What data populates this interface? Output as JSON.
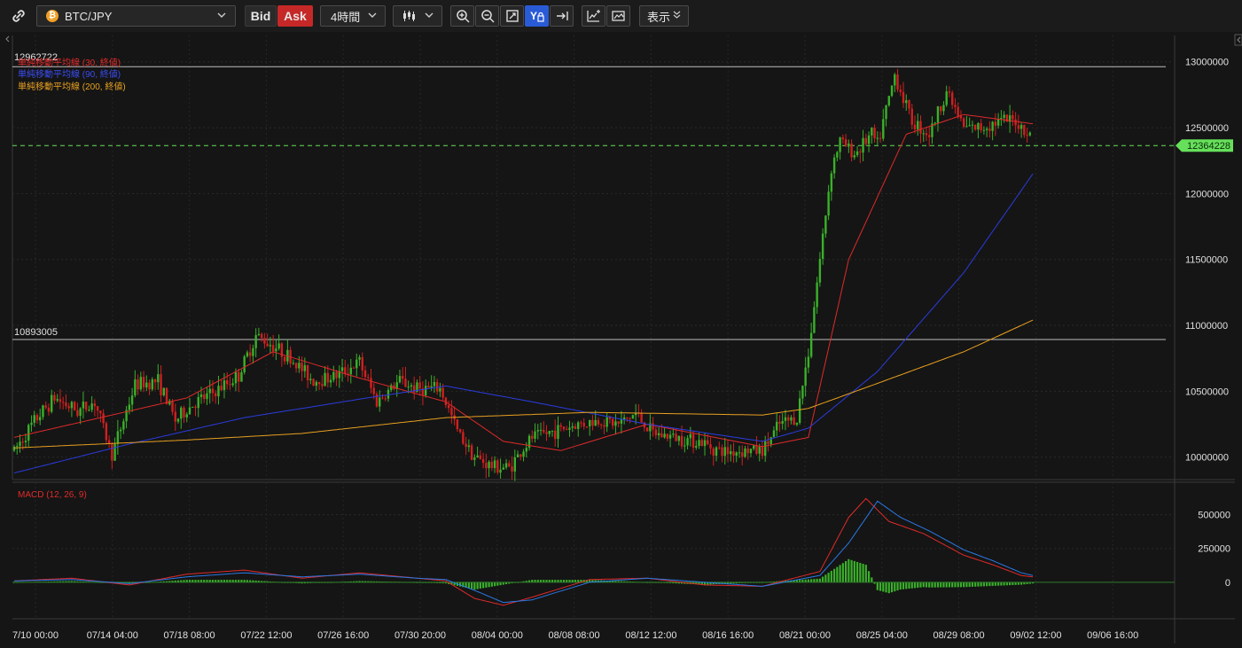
{
  "toolbar": {
    "symbol": "BTC/JPY",
    "bid_label": "Bid",
    "ask_label": "Ask",
    "timeframe": "4時間",
    "display_label": "表示",
    "icons": [
      "link-icon",
      "bitcoin-icon",
      "chevron-down-icon",
      "candlestick-icon",
      "zoom-in-icon",
      "zoom-out-icon",
      "fit-icon",
      "yen-lock-icon",
      "scroll-to-end-icon",
      "add-indicator-icon",
      "screenshot-icon"
    ]
  },
  "colors": {
    "up_candle": "#3ab02a",
    "down_candle": "#d02020",
    "sma30": "#e02a2a",
    "sma90": "#2a3ce0",
    "sma200": "#e8a020",
    "price_line": "#66e05a",
    "bid_bg": "#2a2a2a",
    "ask_bg": "#c62828",
    "active_toggle": "#2a5bd7"
  },
  "main_chart": {
    "legend": [
      "単純移動平均線 (30, 終値)",
      "単純移動平均線 (90, 終値)",
      "単純移動平均線 (200, 終値)"
    ],
    "high_line_label": "12962722",
    "low_line_label": "10893005",
    "high_line_value": 12962722,
    "low_line_value": 10893005,
    "current_price_label": "12364228",
    "current_price_value": 12364228
  },
  "macd_chart": {
    "label": "MACD (12, 26, 9)"
  },
  "chart_data": {
    "type": "line",
    "title": "",
    "xlabel": "",
    "ylabel": "",
    "x_ticks": [
      "7/10 00:00",
      "07/14 04:00",
      "07/18 08:00",
      "07/22 12:00",
      "07/26 16:00",
      "07/30 20:00",
      "08/04 00:00",
      "08/08 08:00",
      "08/12 12:00",
      "08/16 16:00",
      "08/21 00:00",
      "08/25 04:00",
      "08/29 08:00",
      "09/02 12:00",
      "09/06 16:00"
    ],
    "price_axis": {
      "ylim": [
        9830000,
        13200000
      ],
      "ticks": [
        "13000000",
        "12500000",
        "12000000",
        "11500000",
        "11000000",
        "10500000",
        "10000000"
      ],
      "tick_values": [
        13000000,
        12500000,
        12000000,
        11500000,
        11000000,
        10500000,
        10000000
      ]
    },
    "macd_axis": {
      "ylim": [
        -270000,
        740000
      ],
      "ticks": [
        "500000",
        "250000",
        "0"
      ],
      "tick_values": [
        500000,
        250000,
        0
      ]
    },
    "grid": true,
    "candles": {
      "count": 300,
      "anchors": [
        [
          0,
          10050000
        ],
        [
          8,
          10300000
        ],
        [
          14,
          10450000
        ],
        [
          22,
          10350000
        ],
        [
          28,
          10420000
        ],
        [
          34,
          10020000
        ],
        [
          42,
          10550000
        ],
        [
          50,
          10580000
        ],
        [
          56,
          10280000
        ],
        [
          62,
          10400000
        ],
        [
          70,
          10500000
        ],
        [
          78,
          10620000
        ],
        [
          84,
          10920000
        ],
        [
          90,
          10850000
        ],
        [
          96,
          10750000
        ],
        [
          104,
          10580000
        ],
        [
          112,
          10620000
        ],
        [
          120,
          10720000
        ],
        [
          126,
          10420000
        ],
        [
          134,
          10580000
        ],
        [
          140,
          10520000
        ],
        [
          148,
          10520000
        ],
        [
          154,
          10200000
        ],
        [
          160,
          10000000
        ],
        [
          166,
          9930000
        ],
        [
          172,
          9920000
        ],
        [
          180,
          10150000
        ],
        [
          188,
          10200000
        ],
        [
          196,
          10250000
        ],
        [
          204,
          10280000
        ],
        [
          210,
          10250000
        ],
        [
          216,
          10330000
        ],
        [
          222,
          10180000
        ],
        [
          230,
          10150000
        ],
        [
          238,
          10120000
        ],
        [
          246,
          10040000
        ],
        [
          254,
          10050000
        ],
        [
          260,
          10050000
        ],
        [
          266,
          10250000
        ],
        [
          272,
          10300000
        ],
        [
          276,
          10800000
        ],
        [
          280,
          11500000
        ],
        [
          284,
          12200000
        ],
        [
          287,
          12400000
        ],
        [
          292,
          12300000
        ],
        [
          298,
          12450000
        ],
        [
          300,
          12364228
        ]
      ],
      "tail_anchors": [
        [
          300,
          12364228
        ],
        [
          306,
          12900000
        ],
        [
          312,
          12550000
        ],
        [
          318,
          12450000
        ],
        [
          324,
          12780000
        ],
        [
          330,
          12500000
        ],
        [
          336,
          12500000
        ],
        [
          342,
          12550000
        ],
        [
          348,
          12550000
        ],
        [
          354,
          12420000
        ]
      ]
    },
    "series": [
      {
        "name": "単純移動平均線 (30, 終値)",
        "anchors": [
          [
            0,
            10150000
          ],
          [
            60,
            10450000
          ],
          [
            90,
            10800000
          ],
          [
            120,
            10600000
          ],
          [
            150,
            10420000
          ],
          [
            170,
            10120000
          ],
          [
            190,
            10050000
          ],
          [
            220,
            10250000
          ],
          [
            260,
            10080000
          ],
          [
            276,
            10150000
          ],
          [
            290,
            11500000
          ],
          [
            310,
            12450000
          ],
          [
            330,
            12600000
          ],
          [
            354,
            12530000
          ]
        ]
      },
      {
        "name": "単純移動平均線 (90, 終値)",
        "anchors": [
          [
            0,
            9880000
          ],
          [
            40,
            10100000
          ],
          [
            80,
            10300000
          ],
          [
            120,
            10440000
          ],
          [
            150,
            10540000
          ],
          [
            180,
            10420000
          ],
          [
            220,
            10250000
          ],
          [
            260,
            10120000
          ],
          [
            276,
            10220000
          ],
          [
            300,
            10650000
          ],
          [
            330,
            11400000
          ],
          [
            354,
            12150000
          ]
        ]
      },
      {
        "name": "単純移動平均線 (200, 終値)",
        "anchors": [
          [
            0,
            10070000
          ],
          [
            60,
            10130000
          ],
          [
            100,
            10180000
          ],
          [
            150,
            10300000
          ],
          [
            200,
            10340000
          ],
          [
            260,
            10320000
          ],
          [
            276,
            10370000
          ],
          [
            300,
            10560000
          ],
          [
            330,
            10800000
          ],
          [
            354,
            11040000
          ]
        ]
      },
      {
        "name": "MACD",
        "anchors": [
          [
            0,
            10000
          ],
          [
            20,
            30000
          ],
          [
            40,
            -20000
          ],
          [
            60,
            60000
          ],
          [
            80,
            90000
          ],
          [
            100,
            30000
          ],
          [
            120,
            70000
          ],
          [
            140,
            30000
          ],
          [
            150,
            10000
          ],
          [
            160,
            -120000
          ],
          [
            170,
            -170000
          ],
          [
            180,
            -110000
          ],
          [
            200,
            20000
          ],
          [
            220,
            30000
          ],
          [
            240,
            -20000
          ],
          [
            260,
            -30000
          ],
          [
            280,
            80000
          ],
          [
            290,
            480000
          ],
          [
            296,
            620000
          ],
          [
            304,
            450000
          ],
          [
            316,
            360000
          ],
          [
            330,
            200000
          ],
          [
            340,
            130000
          ],
          [
            350,
            50000
          ],
          [
            354,
            40000
          ]
        ]
      },
      {
        "name": "Signal",
        "anchors": [
          [
            0,
            10000
          ],
          [
            20,
            20000
          ],
          [
            40,
            -10000
          ],
          [
            60,
            40000
          ],
          [
            80,
            70000
          ],
          [
            100,
            40000
          ],
          [
            120,
            60000
          ],
          [
            140,
            30000
          ],
          [
            150,
            20000
          ],
          [
            160,
            -60000
          ],
          [
            170,
            -150000
          ],
          [
            180,
            -130000
          ],
          [
            200,
            0
          ],
          [
            220,
            30000
          ],
          [
            240,
            0
          ],
          [
            260,
            -30000
          ],
          [
            280,
            50000
          ],
          [
            290,
            290000
          ],
          [
            300,
            600000
          ],
          [
            308,
            480000
          ],
          [
            318,
            380000
          ],
          [
            330,
            240000
          ],
          [
            340,
            160000
          ],
          [
            350,
            70000
          ],
          [
            354,
            50000
          ]
        ]
      }
    ]
  }
}
